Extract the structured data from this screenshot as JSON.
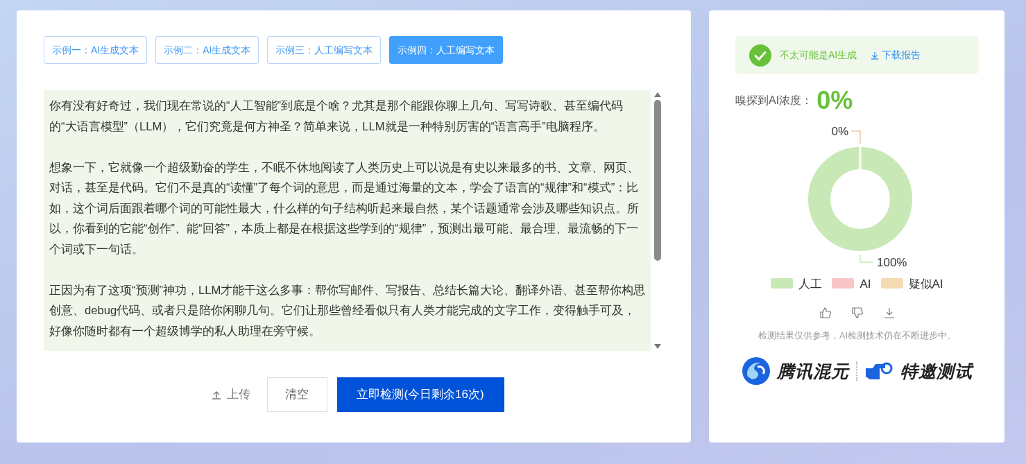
{
  "examples": [
    {
      "label": "示例一：AI生成文本",
      "selected": false
    },
    {
      "label": "示例二：AI生成文本",
      "selected": false
    },
    {
      "label": "示例三：人工编写文本",
      "selected": false
    },
    {
      "label": "示例四：人工编写文本",
      "selected": true
    }
  ],
  "text_field": {
    "paragraphs": [
      "你有没有好奇过，我们现在常说的“人工智能”到底是个啥？尤其是那个能跟你聊上几句、写写诗歌、甚至编代码的“大语言模型”（LLM），它们究竟是何方神圣？简单来说，LLM就是一种特别厉害的“语言高手”电脑程序。",
      "想象一下，它就像一个超级勤奋的学生，不眠不休地阅读了人类历史上可以说是有史以来最多的书、文章、网页、对话，甚至是代码。它们不是真的“读懂”了每个词的意思，而是通过海量的文本，学会了语言的“规律”和“模式”：比如，这个词后面跟着哪个词的可能性最大，什么样的句子结构听起来最自然，某个话题通常会涉及哪些知识点。所以，你看到的它能“创作”、能“回答”，本质上都是在根据这些学到的“规律”，预测出最可能、最合理、最流畅的下一个词或下一句话。",
      "正因为有了这项“预测”神功，LLM才能干这么多事：帮你写邮件、写报告、总结长篇大论、翻译外语、甚至帮你构思创意、debug代码、或者只是陪你闲聊几句。它们让那些曾经看似只有人类才能完成的文字工作，变得触手可及，好像你随时都有一个超级博学的私人助理在旁守候。"
    ]
  },
  "actions": {
    "upload": "上传",
    "clear": "清空",
    "detect": "立即检测(今日剩余16次)"
  },
  "result": {
    "verdict": "不太可能是AI生成",
    "download": "下载报告",
    "concentration_label": "嗅探到AI浓度：",
    "concentration": "0%",
    "chart_data": {
      "type": "donut",
      "categories": [
        "人工",
        "AI",
        "疑似AI"
      ],
      "values": [
        100,
        0,
        0
      ],
      "colors": [
        "#c8e8b6",
        "#f9c6c8",
        "#f5dab4"
      ],
      "value_labels": [
        "100%",
        null,
        "0%"
      ]
    },
    "disclaimer": "检测结果仅供参考，AI检测技术仍在不断进步中。"
  },
  "logos": {
    "left": "腾讯混元",
    "right": "特邀测试"
  }
}
